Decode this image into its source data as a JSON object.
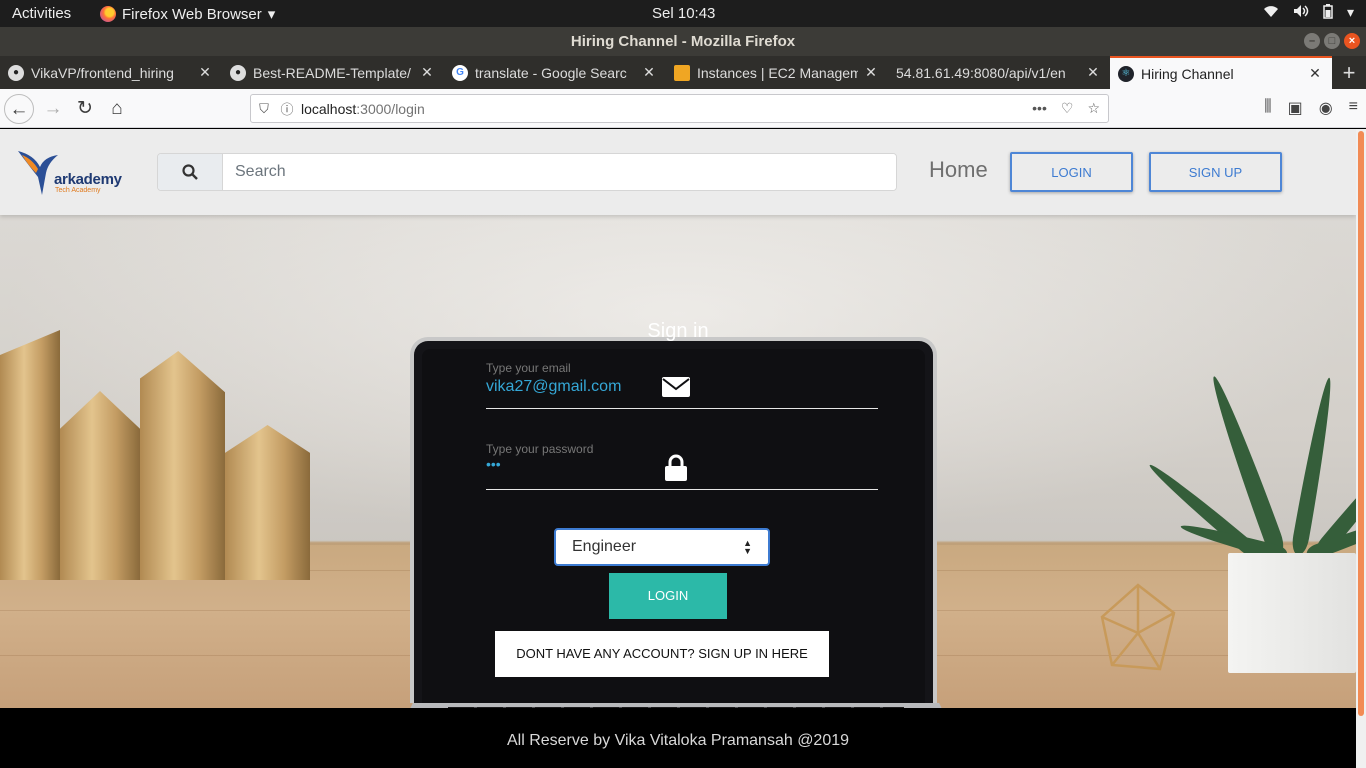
{
  "system": {
    "activities": "Activities",
    "app_menu": "Firefox Web Browser",
    "clock": "Sel 10:43",
    "tray_icons": [
      "wifi-icon",
      "volume-icon",
      "battery-icon",
      "chevron-down-icon"
    ]
  },
  "window": {
    "title": "Hiring Channel - Mozilla Firefox"
  },
  "tabs": [
    {
      "label": "VikaVP/frontend_hiring",
      "icon": "github-icon"
    },
    {
      "label": "Best-README-Template/",
      "icon": "github-icon"
    },
    {
      "label": "translate - Google Searc",
      "icon": "google-icon"
    },
    {
      "label": "Instances | EC2 Managem",
      "icon": "aws-icon"
    },
    {
      "label": "54.81.61.49:8080/api/v1/en",
      "icon": ""
    },
    {
      "label": "Hiring Channel",
      "icon": "react-icon",
      "active": true
    }
  ],
  "url": {
    "host": "localhost",
    "path": ":3000/login"
  },
  "header": {
    "logo_text": "arkademy",
    "logo_sub": "Tech Academy",
    "search_placeholder": "Search",
    "home": "Home",
    "login": "LOGIN",
    "signup": "SIGN UP"
  },
  "form": {
    "title": "Sign in",
    "email_label": "Type your email",
    "email_value": "vika27@gmail.com",
    "password_label": "Type your password",
    "password_value": "•••",
    "role_selected": "Engineer",
    "login_button": "LOGIN",
    "signup_link": "DONT HAVE ANY ACCOUNT? SIGN UP IN HERE"
  },
  "footer": {
    "text": "All Reserve by Vika Vitaloka Pramansah @2019"
  },
  "colors": {
    "accent": "#e95420",
    "login_button": "#2cb9a8",
    "link_blue": "#3d7bd1",
    "email_text": "#35a7d6"
  }
}
